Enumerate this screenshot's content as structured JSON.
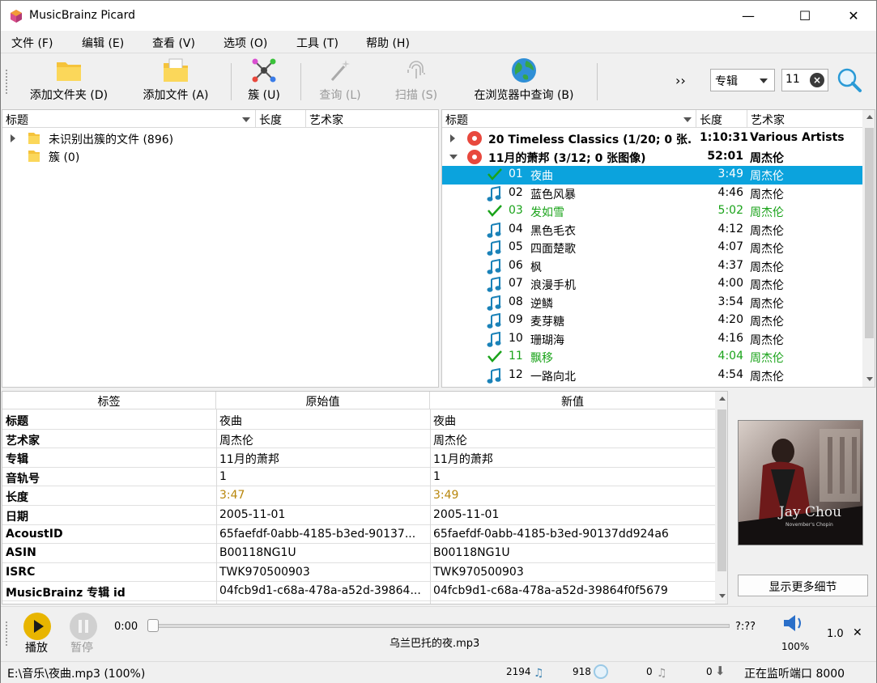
{
  "window": {
    "title": "MusicBrainz Picard",
    "minimize": "—",
    "maximize": "☐",
    "close": "✕"
  },
  "menu": [
    "文件 (F)",
    "编辑 (E)",
    "查看 (V)",
    "选项 (O)",
    "工具 (T)",
    "帮助 (H)"
  ],
  "toolbar": {
    "add_folder": "添加文件夹 (D)",
    "add_files": "添加文件 (A)",
    "cluster": "簇 (U)",
    "lookup": "查询 (L)",
    "scan": "扫描 (S)",
    "browser_lookup": "在浏览器中查询 (B)",
    "more": "››",
    "search_type": "专辑",
    "search_value": "11"
  },
  "left_pane": {
    "headers": {
      "title": "标题",
      "length": "长度",
      "artist": "艺术家"
    },
    "items": [
      {
        "label": "未识别出簇的文件 (896)"
      },
      {
        "label": "簇 (0)"
      }
    ]
  },
  "right_pane": {
    "headers": {
      "title": "标题",
      "length": "长度",
      "artist": "艺术家"
    },
    "albums": [
      {
        "title": "20 Timeless Classics (1/20; 0 张...",
        "length": "1:10:31",
        "artist": "Various Artists"
      },
      {
        "title": "11月的萧邦 (3/12; 0 张图像)",
        "length": "52:01",
        "artist": "周杰伦"
      }
    ],
    "tracks": [
      {
        "num": "01",
        "title": "夜曲",
        "length": "3:49",
        "artist": "周杰伦",
        "state": "selected"
      },
      {
        "num": "02",
        "title": "蓝色风暴",
        "length": "4:46",
        "artist": "周杰伦",
        "state": "note"
      },
      {
        "num": "03",
        "title": "发如雪",
        "length": "5:02",
        "artist": "周杰伦",
        "state": "matched"
      },
      {
        "num": "04",
        "title": "黑色毛衣",
        "length": "4:12",
        "artist": "周杰伦",
        "state": "note"
      },
      {
        "num": "05",
        "title": "四面楚歌",
        "length": "4:07",
        "artist": "周杰伦",
        "state": "note"
      },
      {
        "num": "06",
        "title": "枫",
        "length": "4:37",
        "artist": "周杰伦",
        "state": "note"
      },
      {
        "num": "07",
        "title": "浪漫手机",
        "length": "4:00",
        "artist": "周杰伦",
        "state": "note"
      },
      {
        "num": "08",
        "title": "逆鳞",
        "length": "3:54",
        "artist": "周杰伦",
        "state": "note"
      },
      {
        "num": "09",
        "title": "麦芽糖",
        "length": "4:20",
        "artist": "周杰伦",
        "state": "note"
      },
      {
        "num": "10",
        "title": "珊瑚海",
        "length": "4:16",
        "artist": "周杰伦",
        "state": "note"
      },
      {
        "num": "11",
        "title": "飘移",
        "length": "4:04",
        "artist": "周杰伦",
        "state": "matched"
      },
      {
        "num": "12",
        "title": "一路向北",
        "length": "4:54",
        "artist": "周杰伦",
        "state": "note"
      }
    ]
  },
  "metadata": {
    "headers": {
      "tag": "标签",
      "original": "原始值",
      "new": "新值"
    },
    "rows": [
      {
        "tag": "标题",
        "original": "夜曲",
        "new": "夜曲",
        "changed": false
      },
      {
        "tag": "艺术家",
        "original": "周杰伦",
        "new": "周杰伦",
        "changed": false
      },
      {
        "tag": "专辑",
        "original": "11月的萧邦",
        "new": "11月的萧邦",
        "changed": false
      },
      {
        "tag": "音轨号",
        "original": "1",
        "new": "1",
        "changed": false
      },
      {
        "tag": "长度",
        "original": "3:47",
        "new": "3:49",
        "changed": true
      },
      {
        "tag": "日期",
        "original": "2005-11-01",
        "new": "2005-11-01",
        "changed": false
      },
      {
        "tag": "AcoustID",
        "original": "65faefdf-0abb-4185-b3ed-90137...",
        "new": "65faefdf-0abb-4185-b3ed-90137dd924a6",
        "changed": false
      },
      {
        "tag": "ASIN",
        "original": "B00118NG1U",
        "new": "B00118NG1U",
        "changed": false
      },
      {
        "tag": "ISRC",
        "original": "TWK970500903",
        "new": "TWK970500903",
        "changed": false
      },
      {
        "tag": "MusicBrainz 专辑 id",
        "original": "04fcb9d1-c68a-478a-a52d-39864...",
        "new": "04fcb9d1-c68a-478a-a52d-39864f0f5679",
        "changed": false
      }
    ]
  },
  "cover": {
    "show_more": "显示更多细节",
    "caption": "Jay Chou"
  },
  "player": {
    "play": "播放",
    "pause": "暂停",
    "elapsed": "0:00",
    "remaining": "?:??",
    "progress": 0,
    "filename": "乌兰巴托的夜.mp3",
    "volume": "100%",
    "speed": "1.0",
    "close": "✕"
  },
  "status": {
    "path": "E:\\音乐\\夜曲.mp3 (100%)",
    "files": "2194",
    "albums": "918",
    "pending": "0",
    "downloads": "0",
    "listening": "正在监听端口 8000"
  },
  "colors": {
    "selection": "#0ba3dd",
    "matched": "#1aa31a",
    "changed": "#b8860b"
  }
}
